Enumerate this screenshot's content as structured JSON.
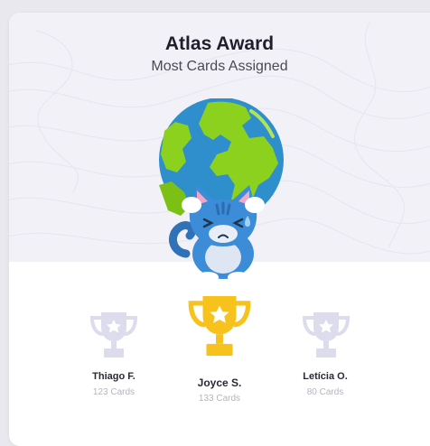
{
  "award": {
    "title": "Atlas Award",
    "subtitle": "Most Cards Assigned"
  },
  "podium": [
    {
      "name": "Thiago F.",
      "count": "123 Cards",
      "trophy": "silver-trophy-icon"
    },
    {
      "name": "Joyce S.",
      "count": "133 Cards",
      "trophy": "gold-trophy-icon"
    },
    {
      "name": "Letícia O.",
      "count": "80 Cards",
      "trophy": "silver-trophy-icon"
    }
  ],
  "colors": {
    "gold": "#f6c21b",
    "silver": "#dcdcec",
    "globe_ocean": "#2e8fcc",
    "globe_land": "#8dd11f",
    "cat": "#3c8cd8"
  }
}
